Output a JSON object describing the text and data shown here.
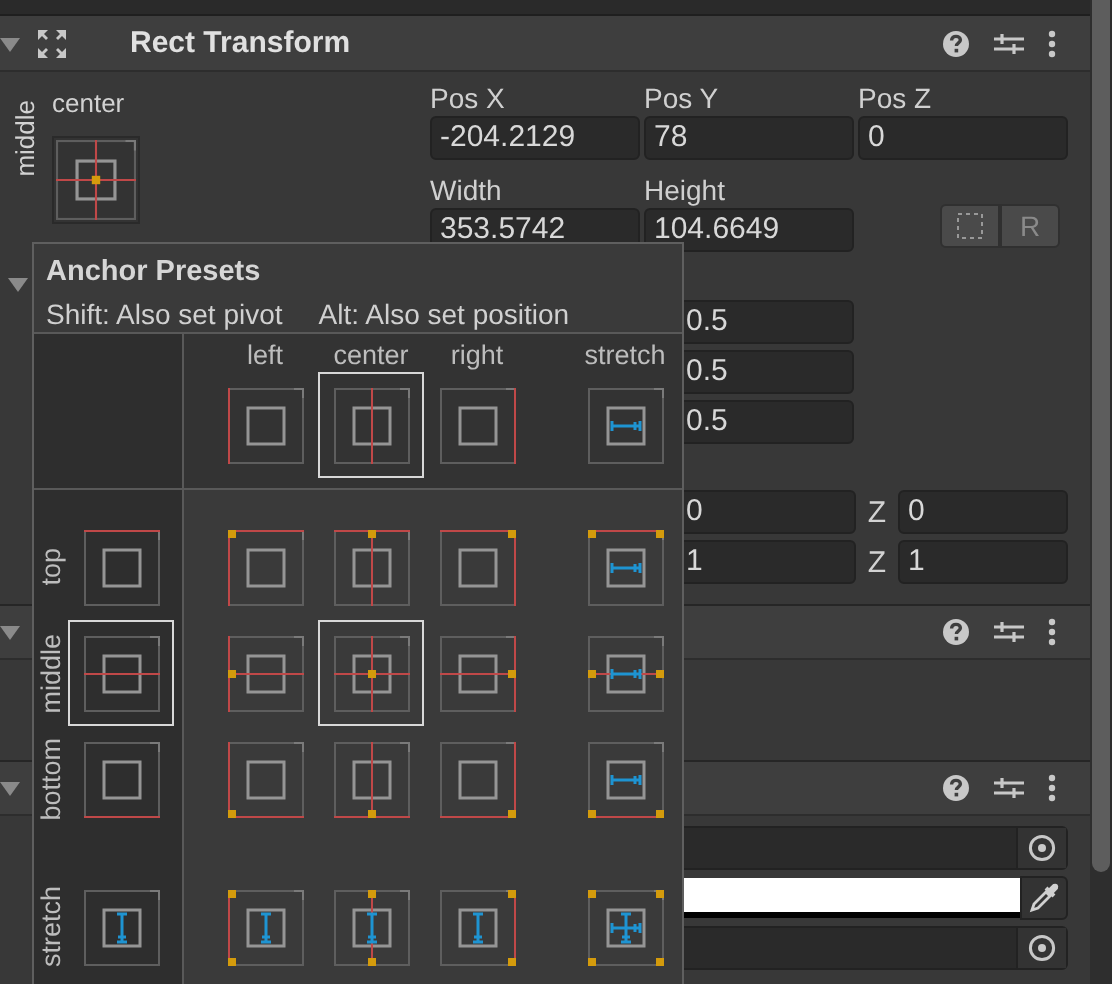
{
  "rect_transform": {
    "title": "Rect Transform",
    "expanded": true,
    "anchor": {
      "h_label": "center",
      "v_label": "middle"
    },
    "position": [
      {
        "label": "Pos X",
        "value": "-204.2129"
      },
      {
        "label": "Pos Y",
        "value": "78"
      },
      {
        "label": "Pos Z",
        "value": "0"
      }
    ],
    "size": [
      {
        "label": "Width",
        "value": "353.5742"
      },
      {
        "label": "Height",
        "value": "104.6649"
      }
    ],
    "raw_edit_button": {
      "label": "R"
    },
    "foldout": {
      "expanded": true
    },
    "value_fields": [
      {
        "value": "0.5"
      },
      {
        "value": "0.5"
      },
      {
        "value": "0.5"
      }
    ],
    "vector_rows": [
      {
        "value": "0",
        "z_label": "Z",
        "z_value": "0"
      },
      {
        "value": "1",
        "z_label": "Z",
        "z_value": "1"
      }
    ]
  },
  "components": [
    {
      "expanded": true
    },
    {
      "expanded": true,
      "fields": [
        {
          "kind": "object"
        },
        {
          "kind": "color",
          "color": "#ffffff"
        },
        {
          "kind": "object"
        }
      ]
    }
  ],
  "anchor_presets": {
    "title": "Anchor Presets",
    "hint_left": "Shift: Also set pivot",
    "hint_right": "Alt: Also set position",
    "columns": [
      {
        "label": "left",
        "kind": "left",
        "selected": false
      },
      {
        "label": "center",
        "kind": "center",
        "selected": true
      },
      {
        "label": "right",
        "kind": "right",
        "selected": false
      },
      {
        "label": "stretch",
        "kind": "stretch",
        "selected": false
      }
    ],
    "rows": [
      {
        "label": "top",
        "kind": "top",
        "selected": false
      },
      {
        "label": "middle",
        "kind": "middle",
        "selected": true
      },
      {
        "label": "bottom",
        "kind": "bottom",
        "selected": false
      },
      {
        "label": "stretch",
        "kind": "stretch",
        "selected": false
      }
    ]
  }
}
